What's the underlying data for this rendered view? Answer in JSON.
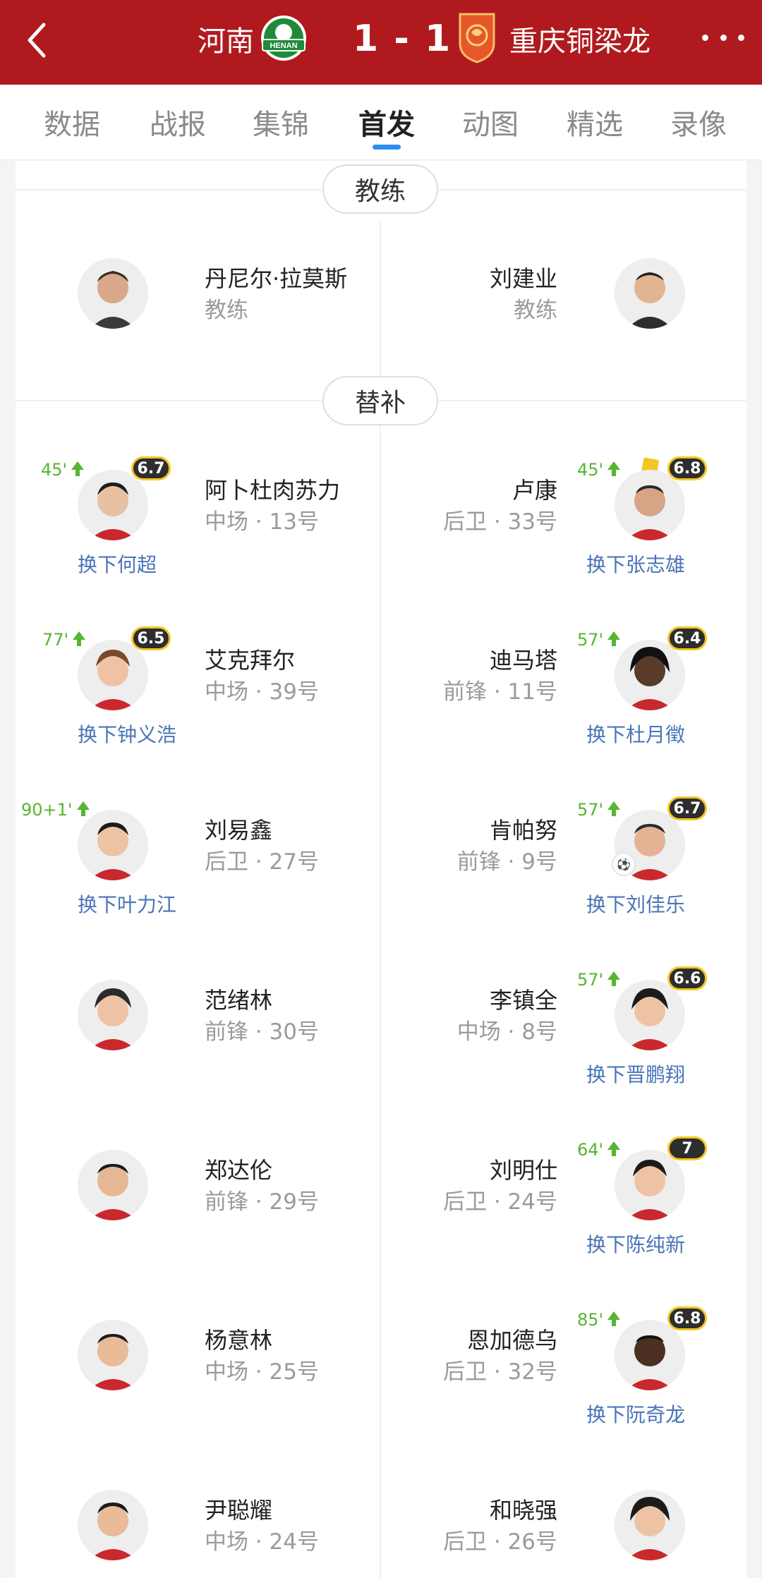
{
  "header": {
    "back_icon": "chevron-left-icon",
    "home_team": "河南",
    "away_team": "重庆铜梁龙",
    "score": "1 - 1",
    "home_logo_text": "HENAN",
    "more_icon": "more-dots-icon",
    "colors": {
      "bar": "#b01a1e"
    }
  },
  "tabs": [
    {
      "label": "数据"
    },
    {
      "label": "战报"
    },
    {
      "label": "集锦"
    },
    {
      "label": "首发"
    },
    {
      "label": "动图"
    },
    {
      "label": "精选"
    },
    {
      "label": "录像"
    }
  ],
  "active_tab": "首发",
  "sections": {
    "coach_title": "教练",
    "bench_title": "替补"
  },
  "coaches": {
    "home": {
      "name": "丹尼尔·拉莫斯",
      "role": "教练"
    },
    "away": {
      "name": "刘建业",
      "role": "教练"
    }
  },
  "bench": {
    "home": [
      {
        "name": "阿卜杜肉苏力",
        "info": "中场 · 13号",
        "minute": "45'",
        "rating": "6.7",
        "sub": "换下何超"
      },
      {
        "name": "艾克拜尔",
        "info": "中场 · 39号",
        "minute": "77'",
        "rating": "6.5",
        "sub": "换下钟义浩"
      },
      {
        "name": "刘易鑫",
        "info": "后卫 · 27号",
        "minute": "90+1'",
        "rating": "",
        "sub": "换下叶力江"
      },
      {
        "name": "范绪林",
        "info": "前锋 · 30号"
      },
      {
        "name": "郑达伦",
        "info": "前锋 · 29号"
      },
      {
        "name": "杨意林",
        "info": "中场 · 25号"
      },
      {
        "name": "尹聪耀",
        "info": "中场 · 24号"
      }
    ],
    "away": [
      {
        "name": "卢康",
        "info": "后卫 · 33号",
        "minute": "45'",
        "rating": "6.8",
        "sub": "换下张志雄",
        "yellow_card": true
      },
      {
        "name": "迪马塔",
        "info": "前锋 · 11号",
        "minute": "57'",
        "rating": "6.4",
        "sub": "换下杜月徵"
      },
      {
        "name": "肯帕努",
        "info": "前锋 · 9号",
        "minute": "57'",
        "rating": "6.7",
        "sub": "换下刘佳乐",
        "assist": true
      },
      {
        "name": "李镇全",
        "info": "中场 · 8号",
        "minute": "57'",
        "rating": "6.6",
        "sub": "换下晋鹏翔"
      },
      {
        "name": "刘明仕",
        "info": "后卫 · 24号",
        "minute": "64'",
        "rating": "7",
        "sub": "换下陈纯新"
      },
      {
        "name": "恩加德乌",
        "info": "后卫 · 32号",
        "minute": "85'",
        "rating": "6.8",
        "sub": "换下阮奇龙"
      },
      {
        "name": "和晓强",
        "info": "后卫 · 26号"
      }
    ]
  }
}
